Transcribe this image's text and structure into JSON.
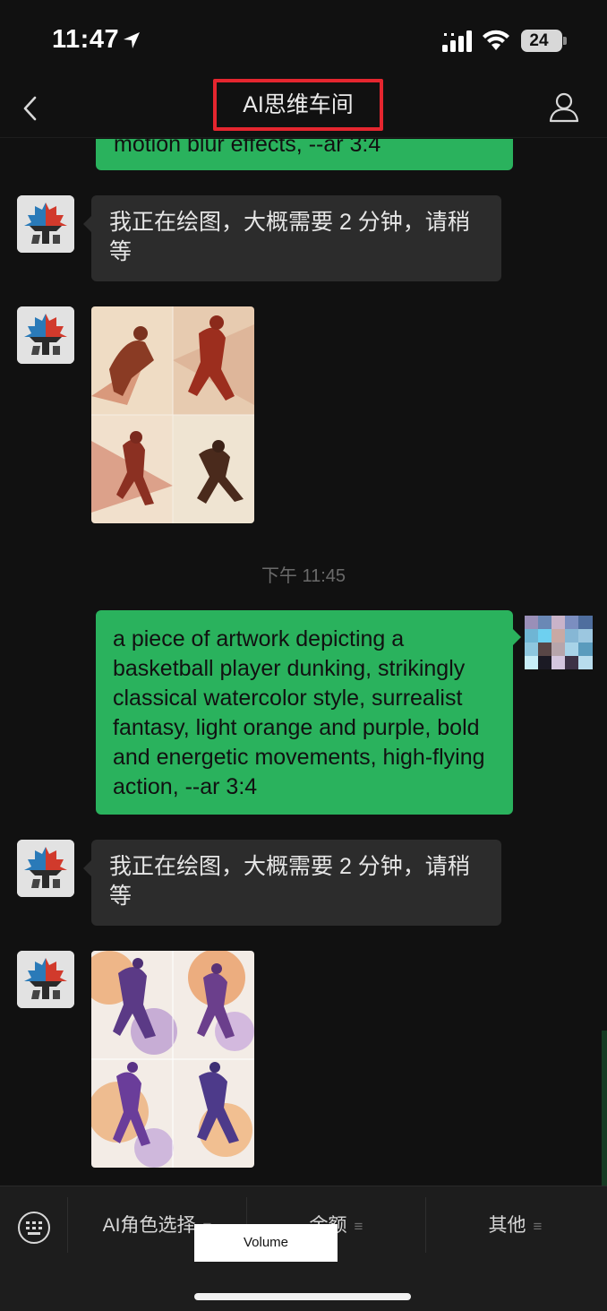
{
  "status_bar": {
    "time": "11:47",
    "battery": "24"
  },
  "nav": {
    "title": "AI思维车间"
  },
  "messages": {
    "prev_tail_text": "motion blur effects, --ar 3:4",
    "bot_wait_1": "我正在绘图，大概需要 2 分钟，请稍等",
    "timestamp": "下午 11:45",
    "user_prompt": "a piece of artwork depicting a basketball player dunking, strikingly  classical watercolor style, surrealist  fantasy, light orange and purple, bold and energetic movements, high-flying action, --ar 3:4",
    "bot_wait_2": "我正在绘图，大概需要 2 分钟，请稍等"
  },
  "bottom_menu": {
    "items": [
      {
        "label": "AI角色选择"
      },
      {
        "label": "余额"
      },
      {
        "label": "其他"
      }
    ],
    "menu_glyph": "≡"
  },
  "volume_hud": {
    "label": "Volume"
  },
  "icons": {
    "location": "location-arrow-icon",
    "signal": "cellular-signal-icon",
    "wifi": "wifi-icon",
    "back": "chevron-left-icon",
    "profile": "person-icon",
    "keyboard": "keyboard-icon"
  },
  "colors": {
    "bubble_green": "#2ab25d",
    "bubble_gray": "#2c2c2c",
    "background": "#111111",
    "highlight_box": "#e5262f"
  }
}
